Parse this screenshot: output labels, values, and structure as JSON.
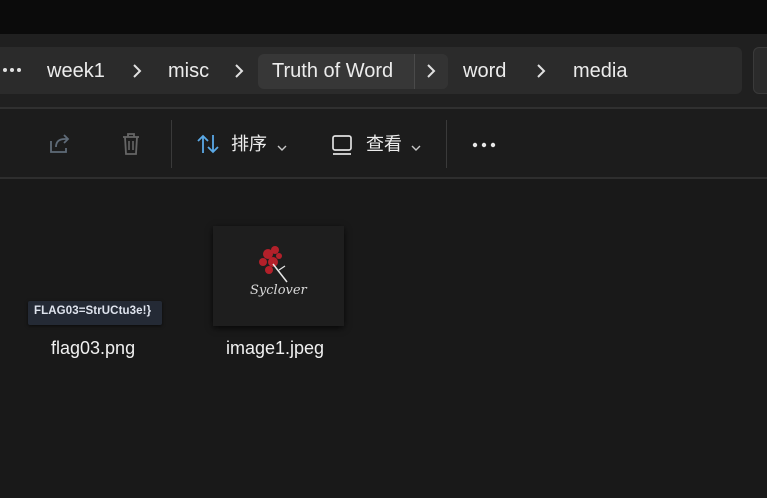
{
  "breadcrumb": {
    "items": [
      "week1",
      "misc",
      "Truth of Word",
      "word",
      "media"
    ]
  },
  "toolbar": {
    "sort_label": "排序",
    "view_label": "查看"
  },
  "files": [
    {
      "name": "flag03.png",
      "thumbnail_text": "FLAG03=StrUCtu3e!}"
    },
    {
      "name": "image1.jpeg",
      "thumbnail_text": "Syclover"
    }
  ],
  "icons": {
    "more": "ellipsis-icon",
    "share": "share-icon",
    "delete": "trash-icon",
    "sort": "sort-arrows-icon",
    "view": "view-layout-icon",
    "overflow": "more-options-icon"
  },
  "colors": {
    "background": "#191919",
    "address_bar": "#2b2b2b",
    "accent_blue": "#5aa9e6",
    "flower_red": "#b3202a"
  }
}
